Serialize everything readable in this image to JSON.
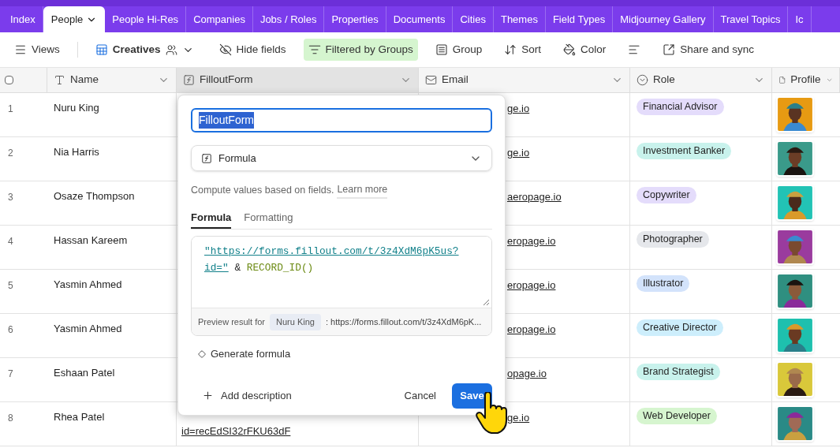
{
  "tabs": [
    {
      "label": "Index",
      "selected": false
    },
    {
      "label": "People",
      "selected": true
    },
    {
      "label": "People Hi-Res",
      "selected": false
    },
    {
      "label": "Companies",
      "selected": false
    },
    {
      "label": "Jobs / Roles",
      "selected": false
    },
    {
      "label": "Properties",
      "selected": false
    },
    {
      "label": "Documents",
      "selected": false
    },
    {
      "label": "Cities",
      "selected": false
    },
    {
      "label": "Themes",
      "selected": false
    },
    {
      "label": "Field Types",
      "selected": false
    },
    {
      "label": "Midjourney Gallery",
      "selected": false
    },
    {
      "label": "Travel Topics",
      "selected": false
    },
    {
      "label": "Ic",
      "selected": false
    }
  ],
  "toolbar": [
    {
      "kind": "views",
      "label": "Views",
      "active": false
    },
    {
      "kind": "view",
      "label": "Creatives",
      "active": false
    },
    {
      "kind": "hide",
      "label": "Hide fields",
      "active": false
    },
    {
      "kind": "filter",
      "label": "Filtered by Groups",
      "active": true
    },
    {
      "kind": "group",
      "label": "Group",
      "active": false
    },
    {
      "kind": "sort",
      "label": "Sort",
      "active": false
    },
    {
      "kind": "color",
      "label": "Color",
      "active": false
    },
    {
      "kind": "height",
      "active": false
    },
    {
      "kind": "share",
      "label": "Share and sync",
      "active": false
    }
  ],
  "select_all": {
    "checked": false
  },
  "columns": [
    {
      "kind": "text",
      "label": "Name",
      "selected": false
    },
    {
      "kind": "formula",
      "label": "FilloutForm",
      "selected": true
    },
    {
      "kind": "email",
      "label": "Email",
      "selected": false
    },
    {
      "kind": "select",
      "label": "Role",
      "selected": false
    },
    {
      "kind": "attachment",
      "label": "Profile",
      "selected": false
    }
  ],
  "rows": [
    {
      "number": "1",
      "name": "Nuru King",
      "email": "ge.io",
      "role": {
        "label": "Financial Advisor",
        "color": "#e4dcfb"
      }
    },
    {
      "number": "2",
      "name": "Nia Harris",
      "email": "ge.io",
      "role": {
        "label": "Investment Banker",
        "color": "#c8f2ec"
      }
    },
    {
      "number": "3",
      "name": "Osaze Thompson",
      "email": "aeropage.io",
      "role": {
        "label": "Copywriter",
        "color": "#e4dcfb"
      }
    },
    {
      "number": "4",
      "name": "Hassan Kareem",
      "email": "eropage.io",
      "role": {
        "label": "Photographer",
        "color": "#e5e7eb"
      }
    },
    {
      "number": "5",
      "name": "Yasmin Ahmed",
      "email": "eropage.io",
      "role": {
        "label": "Illustrator",
        "color": "#d3e3fb"
      }
    },
    {
      "number": "6",
      "name": "Yasmin Ahmed",
      "email": "eropage.io",
      "role": {
        "label": "Creative Director",
        "color": "#cdeefc"
      }
    },
    {
      "number": "7",
      "name": "Eshaan Patel",
      "email": "opage.io",
      "role": {
        "label": "Brand Strategist",
        "color": "#c8f2ec"
      }
    },
    {
      "number": "8",
      "name": "Rhea Patel",
      "filloutform": "id=recEdSI32rFKU63dF",
      "email": "ge.io",
      "role": {
        "label": "Web Developer",
        "color": "#d6f5cf"
      }
    }
  ],
  "popover": {
    "field_name": {
      "value": "FilloutForm",
      "text_selected": true
    },
    "field_type": "Formula",
    "description": "Compute values based on fields.",
    "learn_more": "Learn more",
    "tabs": [
      {
        "label": "Formula",
        "selected": true
      },
      {
        "label": "Formatting",
        "selected": false
      }
    ],
    "formula": [
      {
        "kind": "string",
        "text": "\"https://forms.fillout.com/t/3z4XdM6pK5us?id=\""
      },
      {
        "kind": "operator",
        "text": " & "
      },
      {
        "kind": "function",
        "text": "RECORD_ID()"
      }
    ],
    "preview_label": "Preview result for",
    "preview_record": "Nuru King",
    "preview_value": ": https://forms.fillout.com/t/3z4XdM6pK...",
    "generate": "Generate formula",
    "add_description": "Add description",
    "cancel": "Cancel",
    "save": "Save"
  }
}
